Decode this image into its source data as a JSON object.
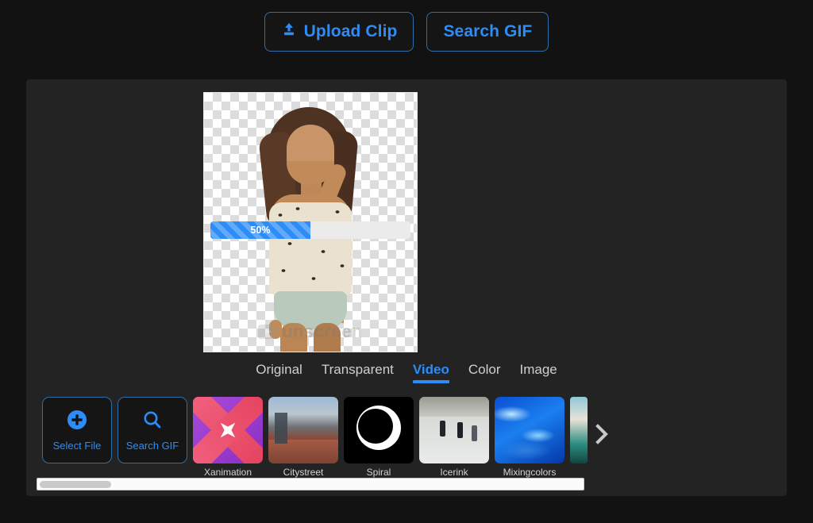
{
  "topbar": {
    "upload_button": {
      "label": "Upload Clip",
      "icon": "upload-icon"
    },
    "search_button": {
      "label": "Search GIF",
      "icon": "search-icon"
    }
  },
  "preview": {
    "progress": {
      "percent_label": "50%",
      "value": 50
    },
    "watermark": "unscreen",
    "background": "transparent-checkerboard"
  },
  "tabs": [
    {
      "label": "Original",
      "active": false
    },
    {
      "label": "Transparent",
      "active": false
    },
    {
      "label": "Video",
      "active": true
    },
    {
      "label": "Color",
      "active": false
    },
    {
      "label": "Image",
      "active": false
    }
  ],
  "rail": {
    "actions": [
      {
        "label": "Select File",
        "icon": "plus-circle-icon"
      },
      {
        "label": "Search GIF",
        "icon": "search-icon"
      }
    ],
    "thumbnails": [
      {
        "caption": "Xanimation",
        "art": "th-x"
      },
      {
        "caption": "Citystreet",
        "art": "th-street"
      },
      {
        "caption": "Spiral",
        "art": "th-spiral"
      },
      {
        "caption": "Icerink",
        "art": "th-ice"
      },
      {
        "caption": "Mixingcolors",
        "art": "th-mix"
      }
    ],
    "next_icon": "chevron-right-icon"
  },
  "colors": {
    "accent": "#2d8cf5",
    "page_background": "#121212",
    "panel_background": "#232323",
    "tab_inactive": "#cfcfcf"
  }
}
